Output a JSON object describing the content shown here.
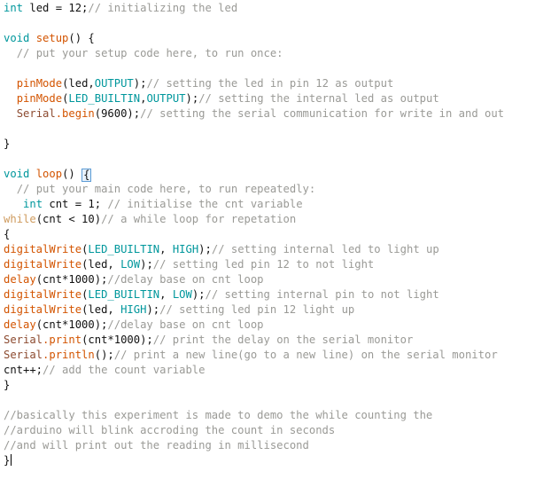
{
  "editor": {
    "language": "arduino",
    "background_color": "#ffffff",
    "font_family": "monospace",
    "caret_visible": true,
    "colors": {
      "keyword": "#00979c",
      "constant": "#00979c",
      "function": "#d35400",
      "control": "#cf9b5e",
      "serial_object": "#8c4a2f",
      "comment": "#9a9a96",
      "plain_text": "#111111",
      "bracket_match_border": "#5b9bd5",
      "bracket_match_fill": "#e8f2fb"
    }
  },
  "lines": [
    {
      "n": 1,
      "tokens": [
        {
          "t": "int",
          "c": "kw"
        },
        {
          "t": " led = 12;",
          "c": "plain"
        },
        {
          "t": "// initializing the led",
          "c": "comment"
        }
      ]
    },
    {
      "n": 2,
      "tokens": []
    },
    {
      "n": 3,
      "tokens": [
        {
          "t": "void",
          "c": "kw"
        },
        {
          "t": " ",
          "c": "plain"
        },
        {
          "t": "setup",
          "c": "fn"
        },
        {
          "t": "() {",
          "c": "plain"
        }
      ]
    },
    {
      "n": 4,
      "tokens": [
        {
          "t": "  ",
          "c": "plain"
        },
        {
          "t": "// put your setup code here, to run once:",
          "c": "comment"
        }
      ]
    },
    {
      "n": 5,
      "tokens": []
    },
    {
      "n": 6,
      "tokens": [
        {
          "t": "  ",
          "c": "plain"
        },
        {
          "t": "pinMode",
          "c": "fn"
        },
        {
          "t": "(led,",
          "c": "plain"
        },
        {
          "t": "OUTPUT",
          "c": "const"
        },
        {
          "t": ");",
          "c": "plain"
        },
        {
          "t": "// setting the led in pin 12 as output",
          "c": "comment"
        }
      ]
    },
    {
      "n": 7,
      "tokens": [
        {
          "t": "  ",
          "c": "plain"
        },
        {
          "t": "pinMode",
          "c": "fn"
        },
        {
          "t": "(",
          "c": "plain"
        },
        {
          "t": "LED_BUILTIN",
          "c": "const"
        },
        {
          "t": ",",
          "c": "plain"
        },
        {
          "t": "OUTPUT",
          "c": "const"
        },
        {
          "t": ");",
          "c": "plain"
        },
        {
          "t": "// setting the internal led as output",
          "c": "comment"
        }
      ]
    },
    {
      "n": 8,
      "tokens": [
        {
          "t": "  ",
          "c": "plain"
        },
        {
          "t": "Serial",
          "c": "serial"
        },
        {
          "t": ".begin",
          "c": "method"
        },
        {
          "t": "(9600);",
          "c": "plain"
        },
        {
          "t": "// setting the serial communication for write in and out",
          "c": "comment"
        }
      ]
    },
    {
      "n": 9,
      "tokens": []
    },
    {
      "n": 10,
      "tokens": [
        {
          "t": "}",
          "c": "brace"
        }
      ]
    },
    {
      "n": 11,
      "tokens": []
    },
    {
      "n": 12,
      "tokens": [
        {
          "t": "void",
          "c": "kw"
        },
        {
          "t": " ",
          "c": "plain"
        },
        {
          "t": "loop",
          "c": "fn"
        },
        {
          "t": "() ",
          "c": "plain"
        },
        {
          "t": "{",
          "c": "brace",
          "highlight": true
        }
      ]
    },
    {
      "n": 13,
      "tokens": [
        {
          "t": "  ",
          "c": "plain"
        },
        {
          "t": "// put your main code here, to run repeatedly:",
          "c": "comment"
        }
      ]
    },
    {
      "n": 14,
      "tokens": [
        {
          "t": "   ",
          "c": "plain"
        },
        {
          "t": "int",
          "c": "kw"
        },
        {
          "t": " cnt = 1; ",
          "c": "plain"
        },
        {
          "t": "// initialise the cnt variable",
          "c": "comment"
        }
      ]
    },
    {
      "n": 15,
      "tokens": [
        {
          "t": "while",
          "c": "ctrl"
        },
        {
          "t": "(cnt < 10)",
          "c": "plain"
        },
        {
          "t": "// a while loop for repetation",
          "c": "comment"
        }
      ]
    },
    {
      "n": 16,
      "tokens": [
        {
          "t": "{",
          "c": "brace"
        }
      ]
    },
    {
      "n": 17,
      "tokens": [
        {
          "t": "digitalWrite",
          "c": "fn"
        },
        {
          "t": "(",
          "c": "plain"
        },
        {
          "t": "LED_BUILTIN",
          "c": "const"
        },
        {
          "t": ", ",
          "c": "plain"
        },
        {
          "t": "HIGH",
          "c": "const"
        },
        {
          "t": ");",
          "c": "plain"
        },
        {
          "t": "// setting internal led to light up",
          "c": "comment"
        }
      ]
    },
    {
      "n": 18,
      "tokens": [
        {
          "t": "digitalWrite",
          "c": "fn"
        },
        {
          "t": "(led, ",
          "c": "plain"
        },
        {
          "t": "LOW",
          "c": "const"
        },
        {
          "t": ");",
          "c": "plain"
        },
        {
          "t": "// setting led pin 12 to not light",
          "c": "comment"
        }
      ]
    },
    {
      "n": 19,
      "tokens": [
        {
          "t": "delay",
          "c": "fn"
        },
        {
          "t": "(cnt*1000);",
          "c": "plain"
        },
        {
          "t": "//delay base on cnt loop",
          "c": "comment"
        }
      ]
    },
    {
      "n": 20,
      "tokens": [
        {
          "t": "digitalWrite",
          "c": "fn"
        },
        {
          "t": "(",
          "c": "plain"
        },
        {
          "t": "LED_BUILTIN",
          "c": "const"
        },
        {
          "t": ", ",
          "c": "plain"
        },
        {
          "t": "LOW",
          "c": "const"
        },
        {
          "t": ");",
          "c": "plain"
        },
        {
          "t": "// setting internal pin to not light",
          "c": "comment"
        }
      ]
    },
    {
      "n": 21,
      "tokens": [
        {
          "t": "digitalWrite",
          "c": "fn"
        },
        {
          "t": "(led, ",
          "c": "plain"
        },
        {
          "t": "HIGH",
          "c": "const"
        },
        {
          "t": ");",
          "c": "plain"
        },
        {
          "t": "// setting led pin 12 light up",
          "c": "comment"
        }
      ]
    },
    {
      "n": 22,
      "tokens": [
        {
          "t": "delay",
          "c": "fn"
        },
        {
          "t": "(cnt*1000);",
          "c": "plain"
        },
        {
          "t": "//delay base on cnt loop",
          "c": "comment"
        }
      ]
    },
    {
      "n": 23,
      "tokens": [
        {
          "t": "Serial",
          "c": "serial"
        },
        {
          "t": ".print",
          "c": "method"
        },
        {
          "t": "(cnt*1000);",
          "c": "plain"
        },
        {
          "t": "// print the delay on the serial monitor",
          "c": "comment"
        }
      ]
    },
    {
      "n": 24,
      "tokens": [
        {
          "t": "Serial",
          "c": "serial"
        },
        {
          "t": ".println",
          "c": "method"
        },
        {
          "t": "();",
          "c": "plain"
        },
        {
          "t": "// print a new line(go to a new line) on the serial monitor",
          "c": "comment"
        }
      ]
    },
    {
      "n": 25,
      "tokens": [
        {
          "t": "cnt++;",
          "c": "plain"
        },
        {
          "t": "// add the count variable",
          "c": "comment"
        }
      ]
    },
    {
      "n": 26,
      "tokens": [
        {
          "t": "}",
          "c": "brace"
        }
      ]
    },
    {
      "n": 27,
      "tokens": []
    },
    {
      "n": 28,
      "tokens": [
        {
          "t": "//basically this experiment is made to demo the while counting the",
          "c": "comment"
        }
      ]
    },
    {
      "n": 29,
      "tokens": [
        {
          "t": "//arduino will blink accroding the count in seconds",
          "c": "comment"
        }
      ]
    },
    {
      "n": 30,
      "tokens": [
        {
          "t": "//and will print out the reading in millisecond",
          "c": "comment"
        }
      ]
    },
    {
      "n": 31,
      "tokens": [
        {
          "t": "}",
          "c": "brace",
          "caret_after": true
        }
      ]
    }
  ]
}
